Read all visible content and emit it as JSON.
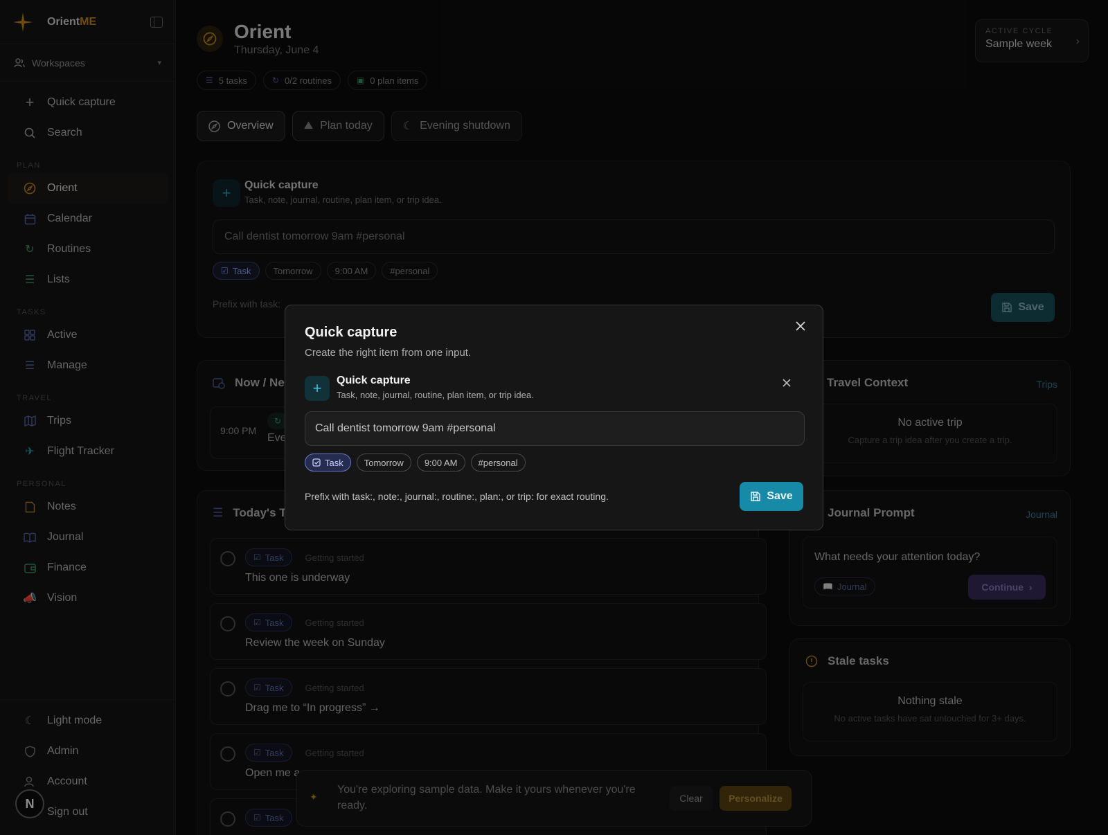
{
  "brand": {
    "name_main": "Orient",
    "name_accent": "ME"
  },
  "sidebar": {
    "workspaces_label": "Workspaces",
    "quick_capture": "Quick capture",
    "search": "Search",
    "sections": {
      "plan": "PLAN",
      "tasks": "TASKS",
      "travel": "TRAVEL",
      "personal": "PERSONAL"
    },
    "plan_items": [
      {
        "label": "Orient",
        "icon": "compass-icon"
      },
      {
        "label": "Calendar",
        "icon": "calendar-icon"
      },
      {
        "label": "Routines",
        "icon": "refresh-icon"
      },
      {
        "label": "Lists",
        "icon": "list-icon"
      }
    ],
    "task_items": [
      {
        "label": "Active",
        "icon": "grid-icon"
      },
      {
        "label": "Manage",
        "icon": "list-icon"
      }
    ],
    "travel_items": [
      {
        "label": "Trips",
        "icon": "map-icon"
      },
      {
        "label": "Flight Tracker",
        "icon": "plane-icon"
      }
    ],
    "personal_items": [
      {
        "label": "Notes",
        "icon": "note-icon"
      },
      {
        "label": "Journal",
        "icon": "book-icon"
      },
      {
        "label": "Finance",
        "icon": "wallet-icon"
      },
      {
        "label": "Vision",
        "icon": "megaphone-icon"
      }
    ],
    "bottom_items": [
      {
        "label": "Light mode",
        "icon": "moon-icon"
      },
      {
        "label": "Admin",
        "icon": "shield-icon"
      },
      {
        "label": "Account",
        "icon": "user-icon"
      },
      {
        "label": "Sign out",
        "icon": "signout-icon"
      }
    ],
    "avatar_letter": "N"
  },
  "header": {
    "title": "Orient",
    "date": "Thursday, June 4",
    "cycle_label": "ACTIVE CYCLE",
    "cycle_value": "Sample week",
    "pills": [
      "5 tasks",
      "0/2 routines",
      "0 plan items"
    ]
  },
  "tabs": [
    "Overview",
    "Plan today",
    "Evening shutdown"
  ],
  "quick_capture_card": {
    "title": "Quick capture",
    "subtitle": "Task, note, journal, routine, plan item, or trip idea.",
    "input_value": "Call dentist tomorrow 9am #personal",
    "chips": [
      "Task",
      "Tomorrow",
      "9:00 AM",
      "#personal"
    ],
    "prefix_text": "Prefix with task:",
    "save_label": "Save"
  },
  "now_next": {
    "title": "Now / Ne",
    "time": "9:00 PM",
    "text": "Eve"
  },
  "today": {
    "title": "Today's T",
    "chip_task": "Task",
    "chip_status": "Getting started",
    "tasks": [
      "This one is underway",
      "Review the week on Sunday",
      "Drag me to “In progress” →",
      "Open me a",
      ""
    ]
  },
  "travel": {
    "title": "Travel Context",
    "link": "Trips",
    "empty_title": "No active trip",
    "empty_sub": "Capture a trip idea after you create a trip."
  },
  "journal": {
    "title": "Journal Prompt",
    "link": "Journal",
    "question": "What needs your attention today?",
    "chip": "Journal",
    "continue": "Continue"
  },
  "stale": {
    "title": "Stale tasks",
    "empty_title": "Nothing stale",
    "empty_sub": "No active tasks have sat untouched for 3+ days."
  },
  "toast": {
    "text": "You're exploring sample data. Make it yours whenever you're ready.",
    "clear": "Clear",
    "personalize": "Personalize"
  },
  "modal": {
    "title": "Quick capture",
    "subtitle": "Create the right item from one input.",
    "inner_title": "Quick capture",
    "inner_subtitle": "Task, note, journal, routine, plan item, or trip idea.",
    "input_value": "Call dentist tomorrow 9am #personal",
    "chips": [
      "Task",
      "Tomorrow",
      "9:00 AM",
      "#personal"
    ],
    "prefix_text": "Prefix with task:, note:, journal:, routine:, plan:, or trip: for exact routing.",
    "save_label": "Save"
  },
  "colors": {
    "accent_orange": "#c98a1a",
    "accent_teal": "#168aa6",
    "task_chip": "#6a79c8"
  }
}
